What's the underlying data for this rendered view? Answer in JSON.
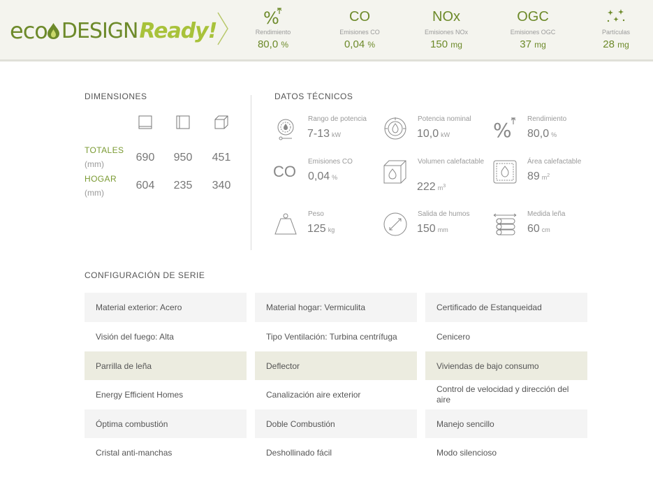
{
  "header": {
    "logo": {
      "eco": "eco",
      "design": "DESIGN",
      "ready": "Ready!"
    },
    "stats": [
      {
        "icon": "percent-icon",
        "label": "Rendimiento",
        "value": "80,0",
        "unit": "%"
      },
      {
        "icon": "co-text-icon",
        "icon_text": "CO",
        "label": "Emisiones CO",
        "value": "0,04",
        "unit": "%"
      },
      {
        "icon": "nox-text-icon",
        "icon_text": "NOx",
        "label": "Emisiones NOx",
        "value": "150",
        "unit": "mg"
      },
      {
        "icon": "ogc-text-icon",
        "icon_text": "OGC",
        "label": "Emisiones OGC",
        "value": "37",
        "unit": "mg"
      },
      {
        "icon": "particles-icon",
        "label": "Partículas",
        "value": "28",
        "unit": "mg"
      }
    ]
  },
  "dimensions": {
    "title": "DIMENSIONES",
    "column_icons": [
      "front-view-icon",
      "side-view-icon",
      "cube-icon"
    ],
    "rows": [
      {
        "label": "TOTALES",
        "unit": "(mm)",
        "values": [
          "690",
          "950",
          "451"
        ]
      },
      {
        "label": "HOGAR",
        "unit": "(mm)",
        "values": [
          "604",
          "235",
          "340"
        ]
      }
    ]
  },
  "tech": {
    "title": "DATOS TÉCNICOS",
    "items": [
      {
        "icon": "power-range-icon",
        "label": "Rango de potencia",
        "value": "7-13",
        "unit": "kW"
      },
      {
        "icon": "nominal-power-icon",
        "label": "Potencia nominal",
        "value": "10,0",
        "unit": "kW"
      },
      {
        "icon": "percent-icon",
        "label": "Rendimiento",
        "value": "80,0",
        "unit": "%"
      },
      {
        "icon": "co-text-icon",
        "icon_text": "CO",
        "label": "Emisiones CO",
        "value": "0,04",
        "unit": "%"
      },
      {
        "icon": "heated-volume-icon",
        "label": "Volumen calefactable",
        "value": "222",
        "unit": "m",
        "unit_sup": "3"
      },
      {
        "icon": "heated-area-icon",
        "label": "Área calefactable",
        "value": "89",
        "unit": "m",
        "unit_sup": "2"
      },
      {
        "icon": "weight-icon",
        "label": "Peso",
        "value": "125",
        "unit": "kg"
      },
      {
        "icon": "flue-outlet-icon",
        "label": "Salida de humos",
        "value": "150",
        "unit": "mm"
      },
      {
        "icon": "firewood-icon",
        "label": "Medida leña",
        "value": "60",
        "unit": "cm"
      }
    ]
  },
  "config": {
    "title": "CONFIGURACIÓN DE SERIE",
    "rows": [
      [
        "Material exterior: Acero",
        "Material hogar: Vermiculita",
        "Certificado de Estanqueidad"
      ],
      [
        "Visión del fuego: Alta",
        "Tipo Ventilación: Turbina centrífuga",
        "Cenicero"
      ],
      [
        "Parrilla de leña",
        "Deflector",
        "Viviendas de bajo consumo"
      ],
      [
        "Energy Efficient Homes",
        "Canalización aire exterior",
        "Control de velocidad y dirección del aire"
      ],
      [
        "Óptima combustión",
        "Doble Combustión",
        "Manejo sencillo"
      ],
      [
        "Cristal anti-manchas",
        "Deshollinado fácil",
        "Modo silencioso"
      ]
    ]
  },
  "colors": {
    "brand_dark": "#6d8a2a",
    "brand_light": "#a8c23a",
    "row_light": "#f4f4f4",
    "row_olive": "#ecece0"
  }
}
